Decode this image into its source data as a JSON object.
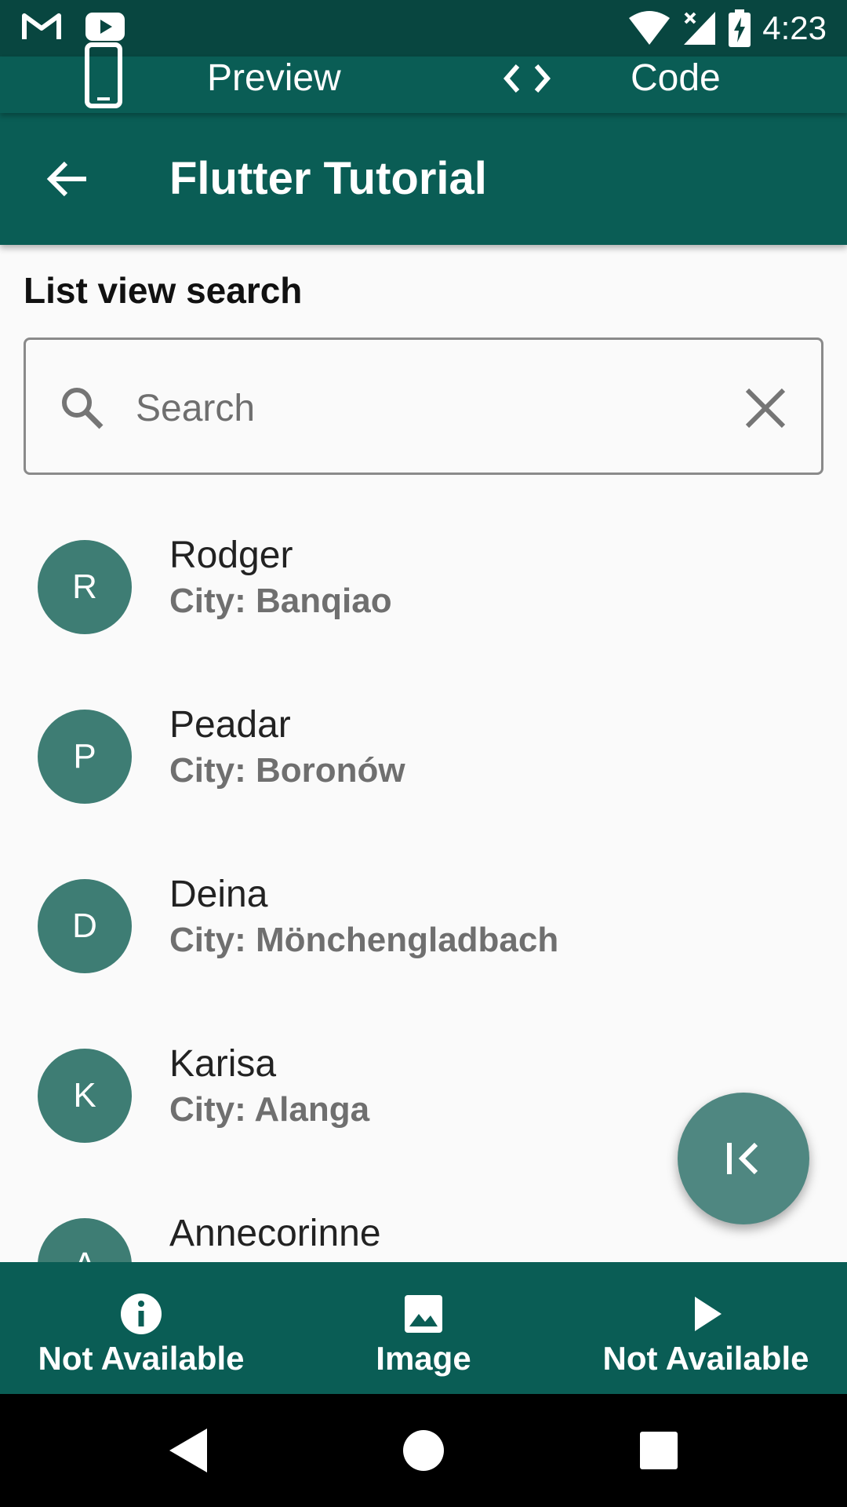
{
  "status_bar": {
    "time": "4:23",
    "icons": [
      "gmail-icon",
      "youtube-icon",
      "wifi-icon",
      "signal-icon",
      "battery-charging-icon"
    ]
  },
  "top_tabs": {
    "preview_label": "Preview",
    "code_label": "Code"
  },
  "app_bar": {
    "title": "Flutter Tutorial"
  },
  "section_title": "List view search",
  "search": {
    "placeholder": "Search",
    "value": ""
  },
  "list": {
    "items": [
      {
        "initial": "R",
        "name": "Rodger",
        "city": "City: Banqiao"
      },
      {
        "initial": "P",
        "name": "Peadar",
        "city": "City: Boronów"
      },
      {
        "initial": "D",
        "name": "Deina",
        "city": "City: Mönchengladbach"
      },
      {
        "initial": "K",
        "name": "Karisa",
        "city": "City: Alanga"
      },
      {
        "initial": "A",
        "name": "Annecorinne",
        "city": ""
      }
    ]
  },
  "fab": {
    "icon": "collapse-left-icon"
  },
  "bottom_nav": {
    "items": [
      {
        "icon": "info-icon",
        "label": "Not Available"
      },
      {
        "icon": "image-icon",
        "label": "Image"
      },
      {
        "icon": "play-icon",
        "label": "Not Available"
      }
    ]
  },
  "system_nav": {
    "icons": [
      "back-triangle-icon",
      "home-circle-icon",
      "recents-square-icon"
    ]
  },
  "colors": {
    "primary_dark": "#084640",
    "primary": "#0a5d55",
    "avatar": "#3e7d74",
    "fab": "#4f8781"
  }
}
